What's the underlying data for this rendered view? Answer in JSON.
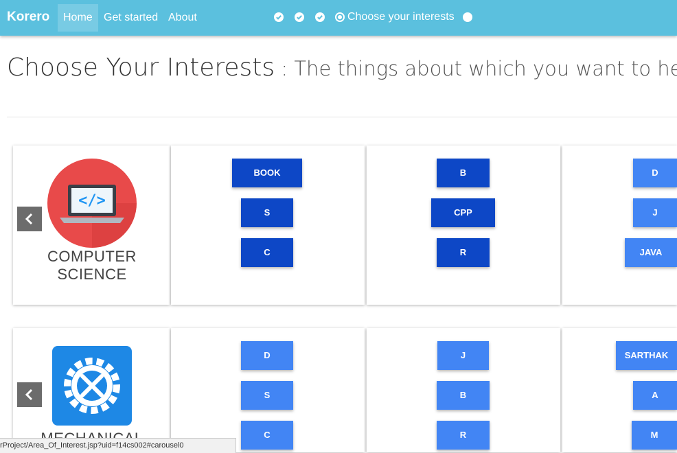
{
  "nav": {
    "brand": "Korero",
    "links": [
      "Home",
      "Get started",
      "About"
    ],
    "steps": {
      "current_label": "Choose your interests"
    }
  },
  "heading": {
    "title": "Choose Your Interests",
    "subtitle": " : The things about which you want to hea"
  },
  "rows": [
    {
      "category": [
        "COMPUTER",
        "SCIENCE"
      ],
      "icon": "laptop-code-icon",
      "columns": [
        [
          "BOOK",
          "S",
          "C"
        ],
        [
          "B",
          "CPP",
          "R"
        ],
        [
          "D",
          "J",
          "JAVA"
        ]
      ]
    },
    {
      "category": [
        "MECHANICAL"
      ],
      "icon": "gear-tools-icon",
      "columns": [
        [
          "D",
          "S",
          "C"
        ],
        [
          "J",
          "B",
          "R"
        ],
        [
          "SARTHAK",
          "A",
          "M"
        ]
      ]
    }
  ],
  "colors": {
    "navbar": "#5bc0de",
    "tag_selected": "#0d47c6",
    "tag_unselected": "#4285f4"
  },
  "statusbar": {
    "url": "rProject/Area_Of_Interest.jsp?uid=f14cs002#carousel0"
  }
}
